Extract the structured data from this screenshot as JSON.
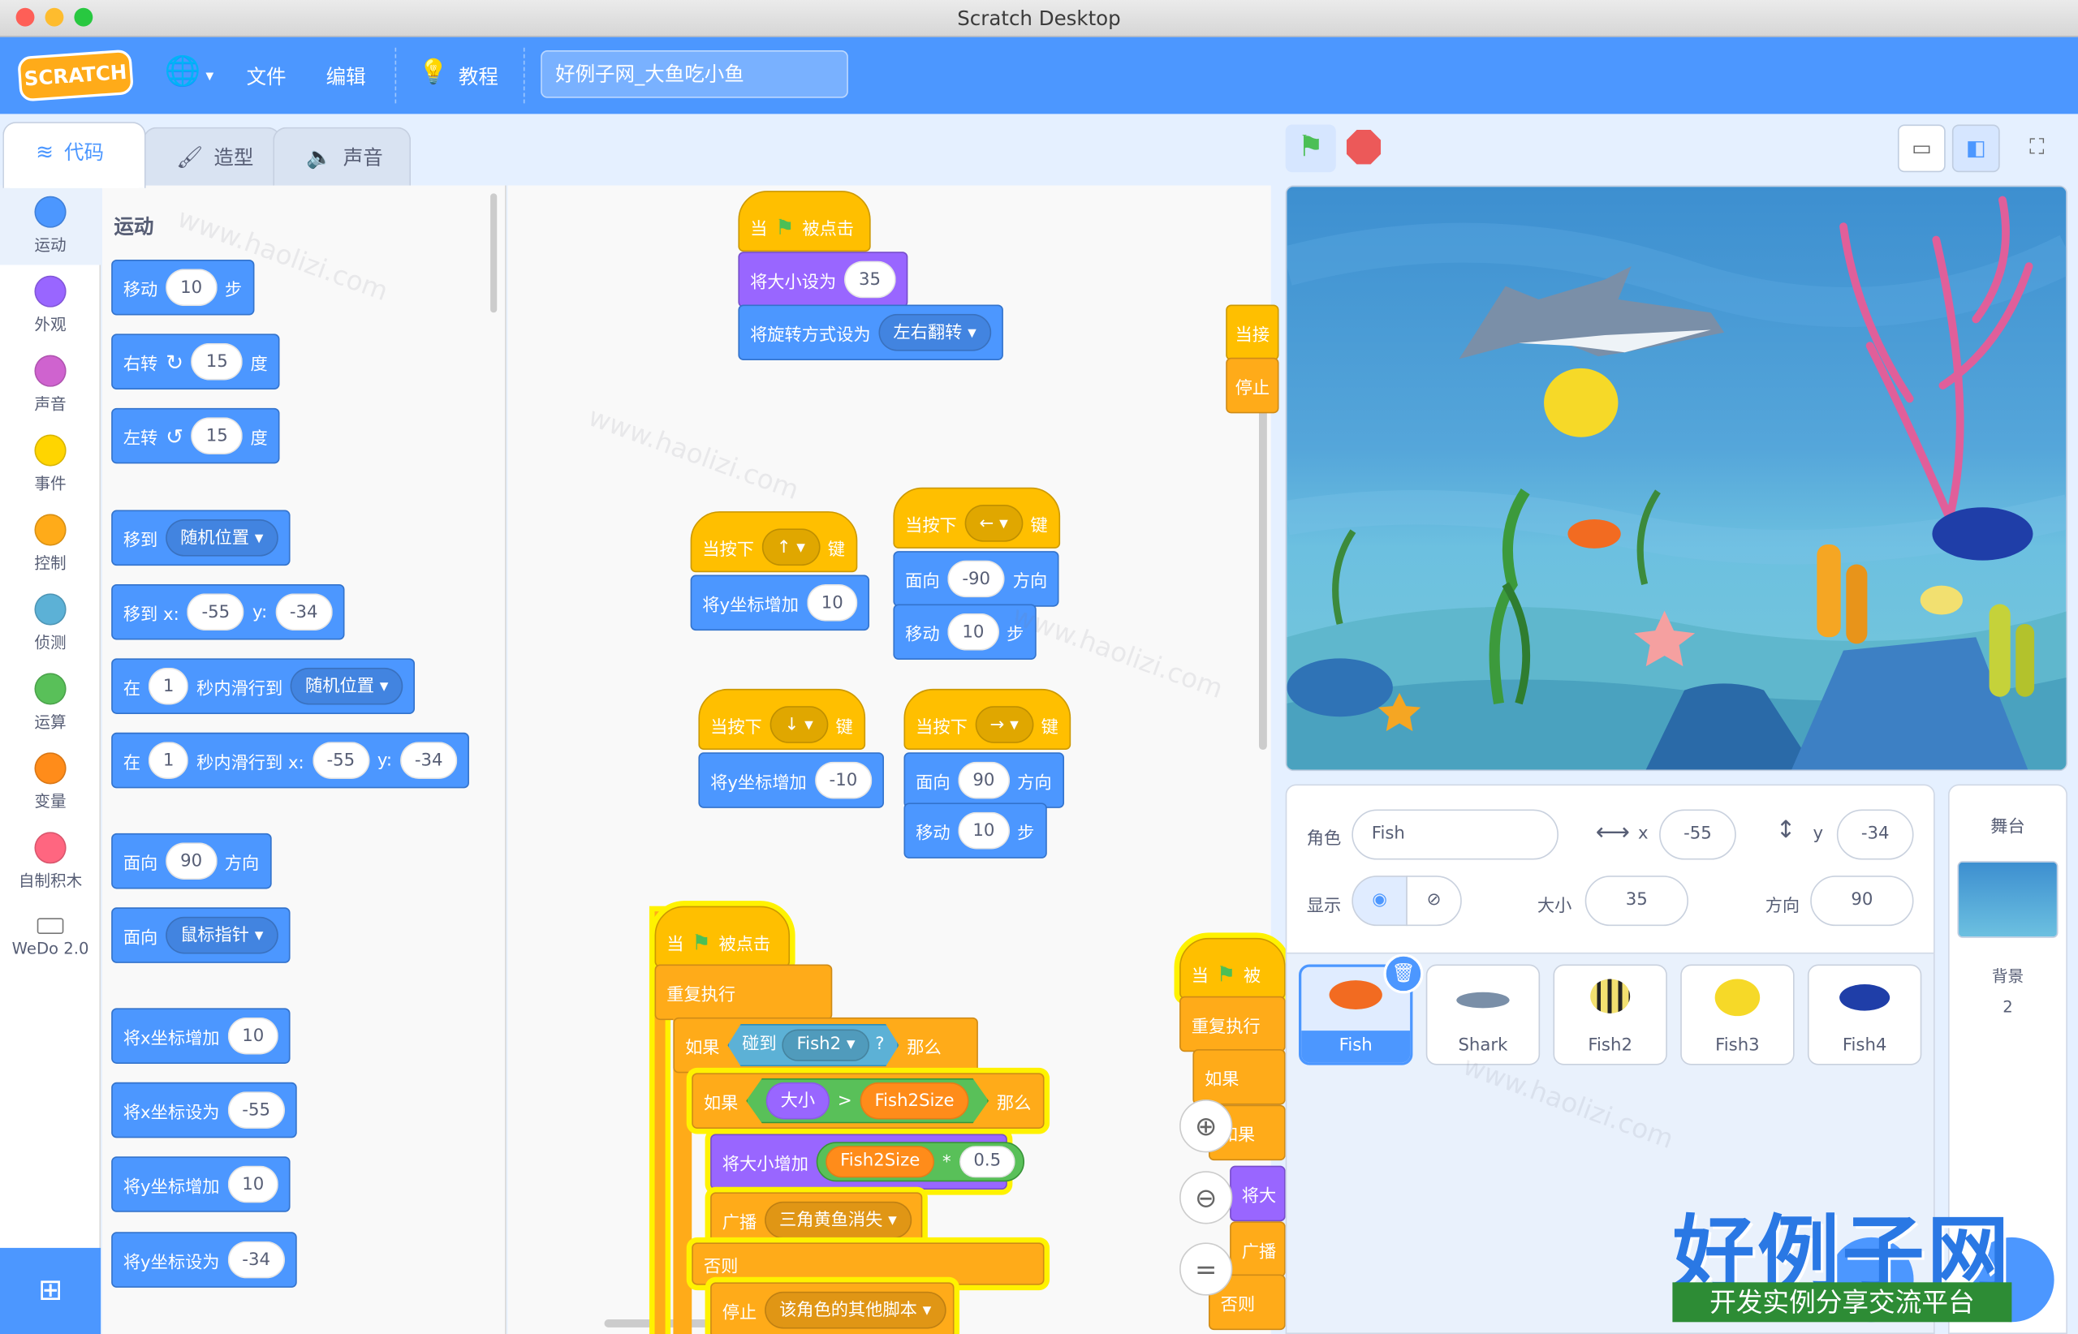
{
  "window": {
    "title": "Scratch Desktop"
  },
  "menubar": {
    "logo_text": "SCRATCH",
    "file": "文件",
    "edit": "编辑",
    "tutorials": "教程",
    "project_title": "好例子网_大鱼吃小鱼"
  },
  "tabs": [
    {
      "label": "代码"
    },
    {
      "label": "造型"
    },
    {
      "label": "声音"
    }
  ],
  "categories": [
    {
      "label": "运动",
      "color": "#4c97ff"
    },
    {
      "label": "外观",
      "color": "#9966ff"
    },
    {
      "label": "声音",
      "color": "#cf63cf"
    },
    {
      "label": "事件",
      "color": "#ffd500"
    },
    {
      "label": "控制",
      "color": "#ffab19"
    },
    {
      "label": "侦测",
      "color": "#5cb1d6"
    },
    {
      "label": "运算",
      "color": "#59c059"
    },
    {
      "label": "变量",
      "color": "#ff8c1a"
    },
    {
      "label": "自制积木",
      "color": "#ff6680"
    },
    {
      "label": "WeDo 2.0",
      "color": "#ffffff"
    }
  ],
  "palette": {
    "section": "运动",
    "move": {
      "a": "移动",
      "v": "10",
      "b": "步"
    },
    "turn_right": {
      "a": "右转",
      "v": "15",
      "b": "度"
    },
    "turn_left": {
      "a": "左转",
      "v": "15",
      "b": "度"
    },
    "goto": {
      "a": "移到",
      "d": "随机位置"
    },
    "goto_xy": {
      "a": "移到 x:",
      "x": "-55",
      "yl": "y:",
      "y": "-34"
    },
    "glide": {
      "a": "在",
      "v": "1",
      "b": "秒内滑行到",
      "d": "随机位置"
    },
    "glide_xy": {
      "a": "在",
      "v": "1",
      "b": "秒内滑行到 x:",
      "x": "-55",
      "yl": "y:",
      "y": "-34"
    },
    "point_dir": {
      "a": "面向",
      "v": "90",
      "b": "方向"
    },
    "point_towards": {
      "a": "面向",
      "d": "鼠标指针"
    },
    "change_x": {
      "a": "将x坐标增加",
      "v": "10"
    },
    "set_x": {
      "a": "将x坐标设为",
      "v": "-55"
    },
    "change_y": {
      "a": "将y坐标增加",
      "v": "10"
    },
    "set_y": {
      "a": "将y坐标设为",
      "v": "-34"
    }
  },
  "scripts": {
    "s1": {
      "hat": "当",
      "hat2": "被点击",
      "set_size": "将大小设为",
      "size": "35",
      "rot": "将旋转方式设为",
      "rot_mode": "左右翻转"
    },
    "s2": {
      "hat": "当按下",
      "key": "↑",
      "hat2": "键",
      "body": "将y坐标增加",
      "v": "10"
    },
    "s3": {
      "hat": "当按下",
      "key": "←",
      "hat2": "键",
      "face": "面向",
      "dir": "-90",
      "face2": "方向",
      "move": "移动",
      "steps": "10",
      "move2": "步"
    },
    "s4": {
      "hat": "当按下",
      "key": "↓",
      "hat2": "键",
      "body": "将y坐标增加",
      "v": "-10"
    },
    "s5": {
      "hat": "当按下",
      "key": "→",
      "hat2": "键",
      "face": "面向",
      "dir": "90",
      "face2": "方向",
      "move": "移动",
      "steps": "10",
      "move2": "步"
    },
    "s6": {
      "hat": "当",
      "hat2": "被点击",
      "forever": "重复执行",
      "if1": "如果",
      "touch": "碰到",
      "touch_target": "Fish2",
      "q": "?",
      "then": "那么",
      "if2": "如果",
      "size": "大小",
      "gt": ">",
      "var": "Fish2Size",
      "then2": "那么",
      "change_size": "将大小增加",
      "mul": "*",
      "factor": "0.5",
      "broadcast": "广播",
      "msg": "三角黄鱼消失",
      "else": "否则",
      "stop": "停止",
      "stop_opt": "该角色的其他脚本"
    },
    "s7": {
      "hat": "当",
      "hat2": "被",
      "forever": "重复执行",
      "if1": "如果",
      "if2": "如果",
      "set": "将大",
      "bc": "广播",
      "else": "否则"
    },
    "partial": {
      "a": "当接",
      "b": "停止"
    }
  },
  "sprite_info": {
    "sprite_label": "角色",
    "sprite_name": "Fish",
    "x_label": "x",
    "x": "-55",
    "y_label": "y",
    "y": "-34",
    "show_label": "显示",
    "size_label": "大小",
    "size": "35",
    "dir_label": "方向",
    "dir": "90"
  },
  "sprites": [
    {
      "name": "Fish"
    },
    {
      "name": "Shark"
    },
    {
      "name": "Fish2"
    },
    {
      "name": "Fish3"
    },
    {
      "name": "Fish4"
    }
  ],
  "stage_pane": {
    "title": "舞台",
    "backdrops_label": "背景",
    "backdrops_count": "2"
  },
  "watermark": {
    "brand": "好例子网",
    "slogan": "开发实例分享交流平台",
    "repeat": "www.haolizi.com"
  }
}
